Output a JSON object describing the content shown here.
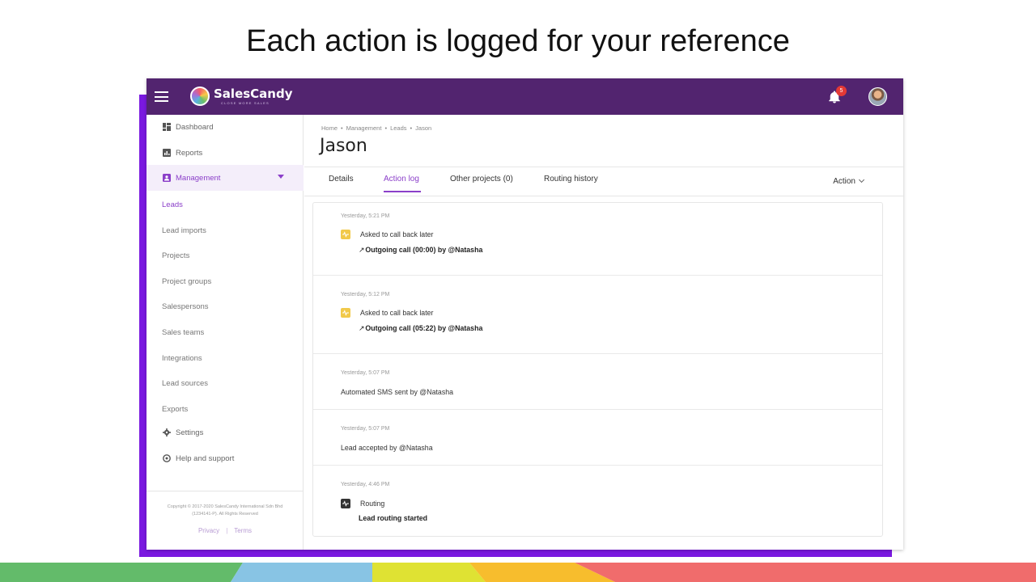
{
  "slide": {
    "title": "Each action is logged for your reference"
  },
  "colors": {
    "topbar": "#52246f",
    "accent": "#8b3fc9",
    "frame": "#7a19e0",
    "badge": "#e53935",
    "call_icon": "#f1c94a"
  },
  "topbar": {
    "logo_name": "SalesCandy",
    "logo_tagline": "CLOSE MORE SALES",
    "notification_count": "5"
  },
  "sidebar": {
    "items": [
      {
        "label": "Dashboard",
        "icon": "dashboard-icon"
      },
      {
        "label": "Reports",
        "icon": "reports-icon"
      },
      {
        "label": "Management",
        "icon": "management-icon"
      }
    ],
    "sub_items": [
      {
        "label": "Leads"
      },
      {
        "label": "Lead imports"
      },
      {
        "label": "Projects"
      },
      {
        "label": "Project groups"
      },
      {
        "label": "Salespersons"
      },
      {
        "label": "Sales teams"
      },
      {
        "label": "Integrations"
      },
      {
        "label": "Lead sources"
      },
      {
        "label": "Exports"
      }
    ],
    "settings_label": "Settings",
    "help_label": "Help and support",
    "copyright_line1": "Copyright © 2017-2020 SalesCandy International Sdn Bhd",
    "copyright_line2": "(1234141-P). All Rights Reserved",
    "privacy_label": "Privacy",
    "separator": "|",
    "terms_label": "Terms"
  },
  "breadcrumb": {
    "items": [
      "Home",
      "Management",
      "Leads",
      "Jason"
    ]
  },
  "page_title": "Jason",
  "tabs": {
    "items": [
      {
        "label": "Details"
      },
      {
        "label": "Action log"
      },
      {
        "label": "Other projects (0)"
      },
      {
        "label": "Routing history"
      }
    ],
    "action_label": "Action"
  },
  "action_log": {
    "entries": [
      {
        "time": "Yesterday, 5:21 PM",
        "text": "Asked to call back later",
        "detail": "Outgoing call (00:00) by @Natasha",
        "arrow": "↗"
      },
      {
        "time": "Yesterday, 5:12 PM",
        "text": "Asked to call back later",
        "detail": "Outgoing call (05:22) by @Natasha",
        "arrow": "↗"
      },
      {
        "time": "Yesterday, 5:07 PM",
        "text": "Automated SMS sent by @Natasha"
      },
      {
        "time": "Yesterday, 5:07 PM",
        "text": "Lead accepted by @Natasha"
      },
      {
        "time": "Yesterday, 4:46 PM",
        "text": "Routing",
        "detail": "Lead routing started"
      }
    ]
  }
}
